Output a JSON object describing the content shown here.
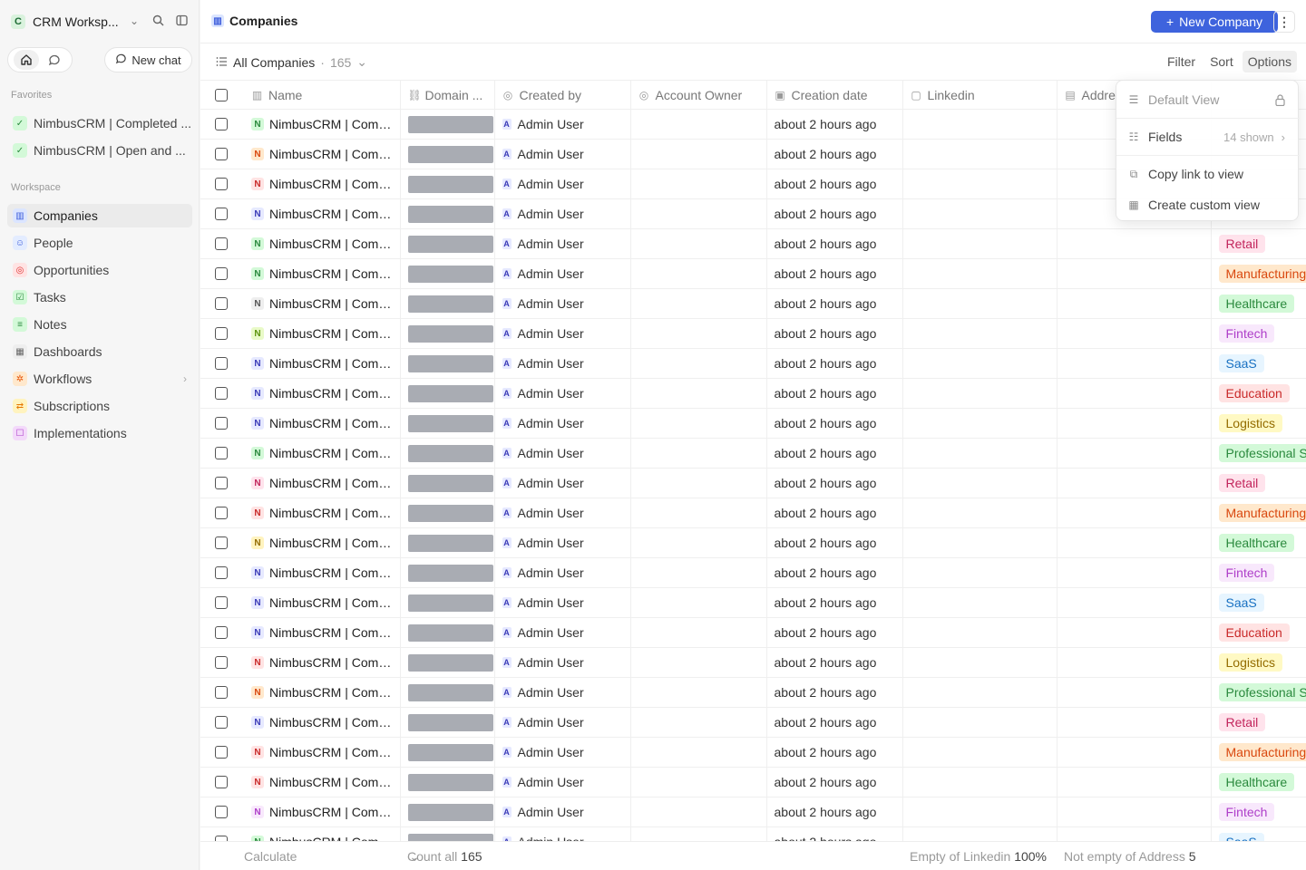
{
  "workspace": {
    "badge": "C",
    "name": "CRM Worksp..."
  },
  "sidebar": {
    "new_chat_label": "New chat",
    "favorites_label": "Favorites",
    "favorites": [
      {
        "label": "NimbusCRM | Completed ..."
      },
      {
        "label": "NimbusCRM | Open and ..."
      }
    ],
    "workspace_label": "Workspace",
    "items": [
      {
        "label": "Companies",
        "icon": "building-icon",
        "color": "#3b5bdb",
        "bg": "#dbe5ff"
      },
      {
        "label": "People",
        "icon": "person-icon",
        "color": "#3b5bdb",
        "bg": "#e3ecff"
      },
      {
        "label": "Opportunities",
        "icon": "target-icon",
        "color": "#e03131",
        "bg": "#ffe3e3"
      },
      {
        "label": "Tasks",
        "icon": "checkbox-icon",
        "color": "#2b8a3e",
        "bg": "#d3f9d8"
      },
      {
        "label": "Notes",
        "icon": "note-icon",
        "color": "#2b8a3e",
        "bg": "#d3f9d8"
      },
      {
        "label": "Dashboards",
        "icon": "grid-icon",
        "color": "#666",
        "bg": "#eeeeee"
      },
      {
        "label": "Workflows",
        "icon": "workflow-icon",
        "color": "#e8590c",
        "bg": "#ffe8cc"
      },
      {
        "label": "Subscriptions",
        "icon": "repeat-icon",
        "color": "#e67700",
        "bg": "#fff3bf"
      },
      {
        "label": "Implementations",
        "icon": "form-icon",
        "color": "#ae3ec9",
        "bg": "#f3d9fa"
      }
    ]
  },
  "header": {
    "title": "Companies",
    "new_button": "New Company"
  },
  "view": {
    "name": "All Companies",
    "count": "165",
    "actions": [
      "Filter",
      "Sort",
      "Options"
    ]
  },
  "table": {
    "columns": [
      "Name",
      "Domain ...",
      "Created by",
      "Account Owner",
      "Creation date",
      "Linkedin",
      "Addre"
    ],
    "rows": [
      {
        "badge_color": "#2b8a3e",
        "badge_bg": "#d3f9d8",
        "tag": "",
        "tag_color": "",
        "tag_bg": ""
      },
      {
        "badge_color": "#d9480f",
        "badge_bg": "#ffe8cc",
        "tag": "",
        "tag_color": "",
        "tag_bg": ""
      },
      {
        "badge_color": "#c92a2a",
        "badge_bg": "#ffe3e3",
        "tag": "",
        "tag_color": "",
        "tag_bg": ""
      },
      {
        "badge_color": "#3b3bb8",
        "badge_bg": "#e6e9ff",
        "tag": "",
        "tag_color": "",
        "tag_bg": ""
      },
      {
        "badge_color": "#2b8a3e",
        "badge_bg": "#d3f9d8",
        "tag": "Retail",
        "tag_color": "#c2255c",
        "tag_bg": "#ffe3ec"
      },
      {
        "badge_color": "#2b8a3e",
        "badge_bg": "#d3f9d8",
        "tag": "Manufacturing",
        "tag_color": "#d9480f",
        "tag_bg": "#ffe8cc"
      },
      {
        "badge_color": "#555555",
        "badge_bg": "#eeeeee",
        "tag": "Healthcare",
        "tag_color": "#2b8a3e",
        "tag_bg": "#d3f9d8"
      },
      {
        "badge_color": "#5c940d",
        "badge_bg": "#e9fac8",
        "tag": "Fintech",
        "tag_color": "#ae3ec9",
        "tag_bg": "#f8e8fc"
      },
      {
        "badge_color": "#3b3bb8",
        "badge_bg": "#e6e9ff",
        "tag": "SaaS",
        "tag_color": "#1971c2",
        "tag_bg": "#e7f5ff"
      },
      {
        "badge_color": "#3b3bb8",
        "badge_bg": "#e6e9ff",
        "tag": "Education",
        "tag_color": "#c92a2a",
        "tag_bg": "#ffe3e3"
      },
      {
        "badge_color": "#3b3bb8",
        "badge_bg": "#e6e9ff",
        "tag": "Logistics",
        "tag_color": "#946c00",
        "tag_bg": "#fff9c4"
      },
      {
        "badge_color": "#2b8a3e",
        "badge_bg": "#d3f9d8",
        "tag": "Professional S",
        "tag_color": "#2b8a3e",
        "tag_bg": "#d3f9d8"
      },
      {
        "badge_color": "#c2255c",
        "badge_bg": "#ffe3ec",
        "tag": "Retail",
        "tag_color": "#c2255c",
        "tag_bg": "#ffe3ec"
      },
      {
        "badge_color": "#c92a2a",
        "badge_bg": "#ffe3e3",
        "tag": "Manufacturing",
        "tag_color": "#d9480f",
        "tag_bg": "#ffe8cc"
      },
      {
        "badge_color": "#946c00",
        "badge_bg": "#fff3bf",
        "tag": "Healthcare",
        "tag_color": "#2b8a3e",
        "tag_bg": "#d3f9d8"
      },
      {
        "badge_color": "#3b3bb8",
        "badge_bg": "#e6e9ff",
        "tag": "Fintech",
        "tag_color": "#ae3ec9",
        "tag_bg": "#f8e8fc"
      },
      {
        "badge_color": "#3b3bb8",
        "badge_bg": "#e6e9ff",
        "tag": "SaaS",
        "tag_color": "#1971c2",
        "tag_bg": "#e7f5ff"
      },
      {
        "badge_color": "#3b3bb8",
        "badge_bg": "#e6e9ff",
        "tag": "Education",
        "tag_color": "#c92a2a",
        "tag_bg": "#ffe3e3"
      },
      {
        "badge_color": "#c92a2a",
        "badge_bg": "#ffe3e3",
        "tag": "Logistics",
        "tag_color": "#946c00",
        "tag_bg": "#fff9c4"
      },
      {
        "badge_color": "#d9480f",
        "badge_bg": "#ffe8cc",
        "tag": "Professional S",
        "tag_color": "#2b8a3e",
        "tag_bg": "#d3f9d8"
      },
      {
        "badge_color": "#3b3bb8",
        "badge_bg": "#e6e9ff",
        "tag": "Retail",
        "tag_color": "#c2255c",
        "tag_bg": "#ffe3ec"
      },
      {
        "badge_color": "#c92a2a",
        "badge_bg": "#ffe3e3",
        "tag": "Manufacturing",
        "tag_color": "#d9480f",
        "tag_bg": "#ffe8cc"
      },
      {
        "badge_color": "#c92a2a",
        "badge_bg": "#ffe3e3",
        "tag": "Healthcare",
        "tag_color": "#2b8a3e",
        "tag_bg": "#d3f9d8"
      },
      {
        "badge_color": "#ae3ec9",
        "badge_bg": "#f8e8fc",
        "tag": "Fintech",
        "tag_color": "#ae3ec9",
        "tag_bg": "#f8e8fc"
      },
      {
        "badge_color": "#2b8a3e",
        "badge_bg": "#d3f9d8",
        "tag": "SaaS",
        "tag_color": "#1971c2",
        "tag_bg": "#e7f5ff"
      }
    ],
    "row_name": "NimbusCRM | Compan...",
    "row_badge": "N",
    "row_user_badge": "A",
    "row_user": "Admin User",
    "row_date": "about 2 hours ago"
  },
  "footer": {
    "calculate": "Calculate",
    "count_label": "Count all",
    "count_value": "165",
    "linkedin_label": "Empty of Linkedin",
    "linkedin_value": "100%",
    "address_label": "Not empty of Address",
    "address_value": "5"
  },
  "options_menu": {
    "default_view": "Default View",
    "fields": "Fields",
    "fields_count": "14 shown",
    "copy_link": "Copy link to view",
    "create_custom": "Create custom view"
  }
}
